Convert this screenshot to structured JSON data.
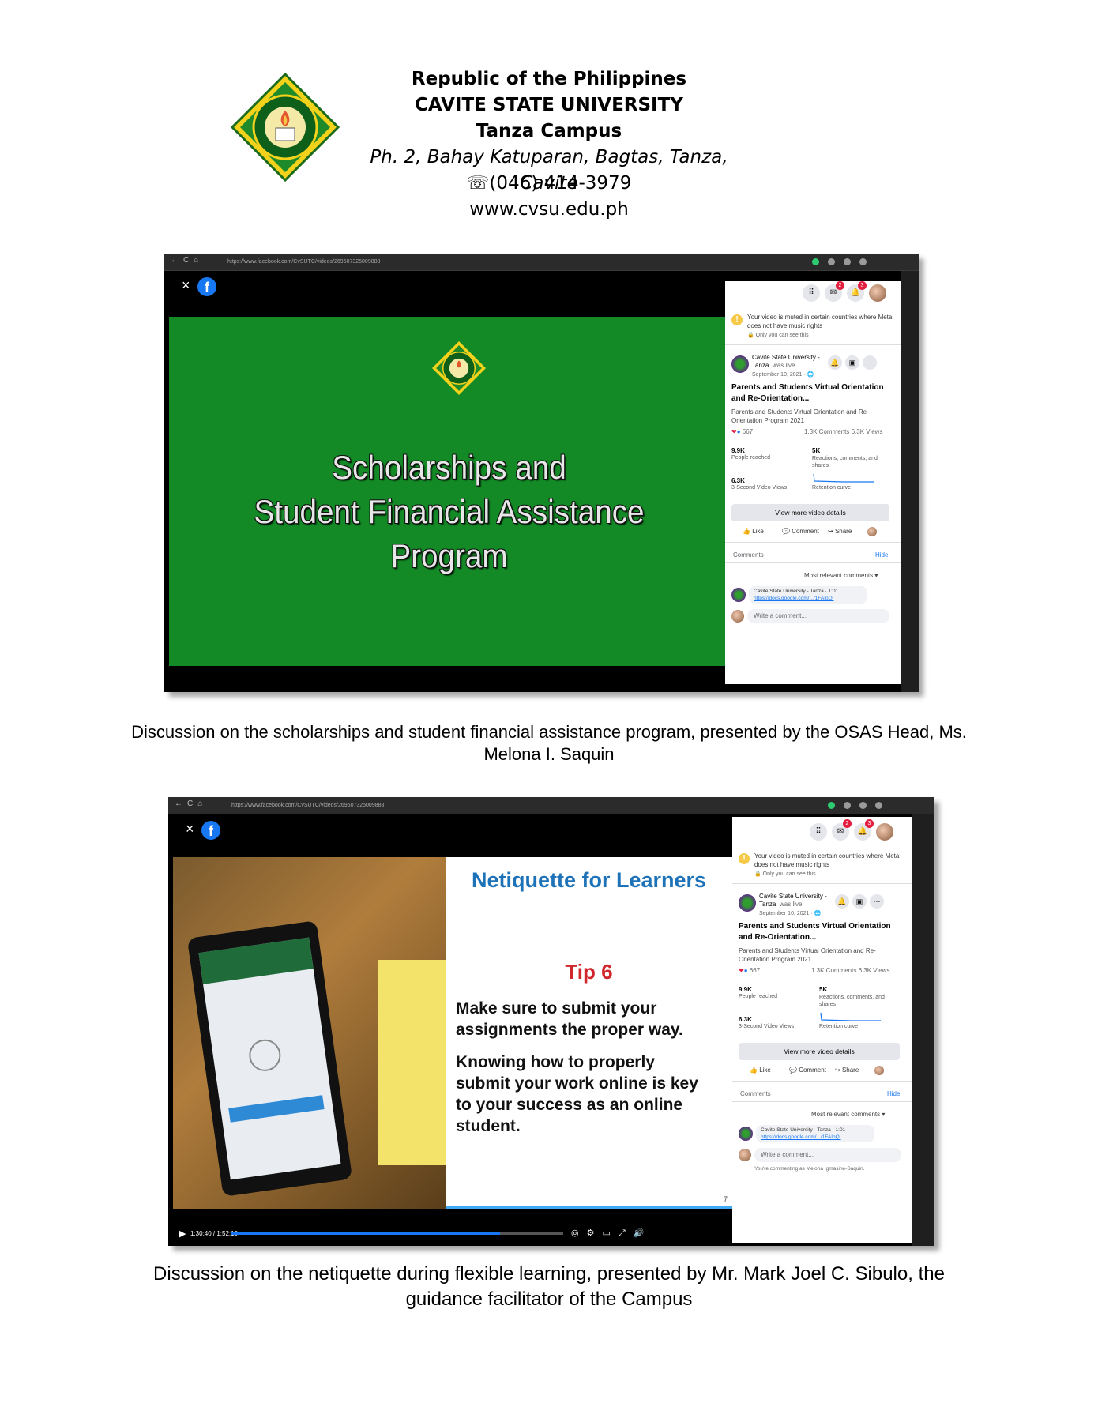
{
  "header": {
    "republic": "Republic of the Philippines",
    "university": "CAVITE STATE UNIVERSITY",
    "campus": "Tanza Campus",
    "address": "Ph. 2, Bahay Katuparan, Bagtas, Tanza, Cavite",
    "phone": "☏(046) 414-3979",
    "website": "www.cvsu.edu.ph",
    "logo_name": "cavite-state-university-seal"
  },
  "screenshot1": {
    "url": "https://www.facebook.com/CvSUTC/videos/269607325009888",
    "close": "×",
    "slide_title_lines": [
      "Scholarships and",
      "Student Financial Assistance",
      "Program"
    ],
    "panel": {
      "notice": "Your video is muted in certain countries where Meta does not have music rights",
      "notice_sub": "🔒 Only you can see this",
      "page_name": "Cavite State University - Tanza",
      "was_live": "was live.",
      "date": "September 10, 2021 · 🌐",
      "post_title": "Parents and Students Virtual Orientation and Re-Orientation...",
      "post_desc": "Parents and Students Virtual Orientation and Re-Orientation Program 2021",
      "reactions": "667",
      "comments_views": "1.3K Comments  6.3K Views",
      "stat1_value": "9.9K",
      "stat1_label": "People reached",
      "stat2_value": "5K",
      "stat2_label": "Reactions, comments, and shares",
      "stat3_value": "6.3K",
      "stat3_label": "3-Second Video Views",
      "stat4_label": "Retention curve",
      "view_more": "View more video details",
      "like": "Like",
      "comment": "Comment",
      "share": "Share",
      "comments_label": "Comments",
      "hide": "Hide",
      "sort": "Most relevant comments ▾",
      "comment_author": "Cavite State University - Tanza · 1:01",
      "comment_link": "https://docs.google.com/.../1FAIpQI",
      "write_placeholder": "Write a comment...",
      "badge1": "2",
      "badge2": "3"
    }
  },
  "caption1": "Discussion on the scholarships and student financial assistance program, presented by the OSAS Head, Ms. Melona I. Saquin",
  "screenshot2": {
    "url": "https://www.facebook.com/CvSUTC/videos/269607325009888",
    "close": "×",
    "slide_heading": "Netiquette for Learners",
    "tip": "Tip 6",
    "body1": "Make sure to submit your assignments the proper way.",
    "body2": "Knowing how to properly submit your work online is key to your success as an online student.",
    "page_number": "7",
    "time": "1:30:40 / 1:52:10",
    "commenting_as": "You're commenting as Melona Igmasine-Saquin.",
    "panel": {
      "notice": "Your video is muted in certain countries where Meta does not have music rights",
      "notice_sub": "🔒 Only you can see this",
      "page_name": "Cavite State University - Tanza",
      "was_live": "was live.",
      "date": "September 10, 2021 · 🌐",
      "post_title": "Parents and Students Virtual Orientation and Re-Orientation...",
      "post_desc": "Parents and Students Virtual Orientation and Re-Orientation Program 2021",
      "reactions": "667",
      "comments_views": "1.3K Comments  6.3K Views",
      "stat1_value": "9.9K",
      "stat1_label": "People reached",
      "stat2_value": "5K",
      "stat2_label": "Reactions, comments, and shares",
      "stat3_value": "6.3K",
      "stat3_label": "3-Second Video Views",
      "stat4_label": "Retention curve",
      "view_more": "View more video details",
      "like": "Like",
      "comment": "Comment",
      "share": "Share",
      "comments_label": "Comments",
      "hide": "Hide",
      "sort": "Most relevant comments ▾",
      "comment_author": "Cavite State University - Tanza · 1:01",
      "comment_link": "https://docs.google.com/.../1FAIpQI",
      "write_placeholder": "Write a comment...",
      "badge1": "2",
      "badge2": "3"
    }
  },
  "caption2": "Discussion on the netiquette during flexible learning, presented by Mr. Mark Joel C. Sibulo, the guidance facilitator of the Campus",
  "colors": {
    "slide_green": "#138a26",
    "facebook_blue": "#1877f2",
    "netiquette_blue": "#1e73b8",
    "tip_red": "#d1262b"
  }
}
